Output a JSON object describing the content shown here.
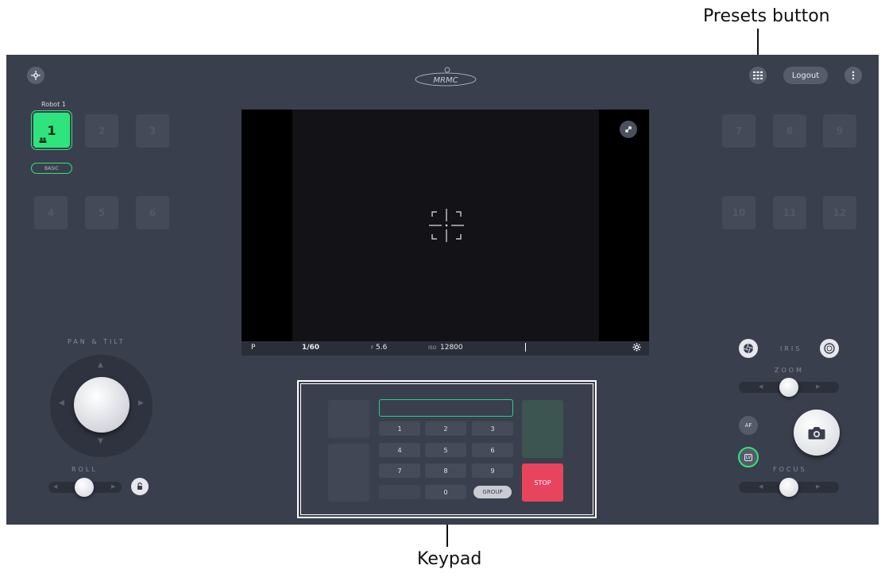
{
  "callouts": {
    "presets": "Presets button",
    "keypad": "Keypad"
  },
  "header": {
    "logo": "MRMC",
    "logout_label": "Logout"
  },
  "robot": {
    "label": "Robot 1",
    "mode_label": "BASIC",
    "left_slots": [
      "1",
      "2",
      "3",
      "4",
      "5",
      "6"
    ],
    "right_slots": [
      "7",
      "8",
      "9",
      "10",
      "11",
      "12"
    ],
    "active_slot": "1"
  },
  "camera_bar": {
    "mode": "P",
    "shutter": "1/60",
    "aperture_prefix": "F",
    "aperture": "5.6",
    "iso_prefix": "ISO",
    "iso": "12800"
  },
  "left_panel": {
    "pan_tilt_label": "PAN & TILT",
    "roll_label": "ROLL"
  },
  "keypad": {
    "keys": [
      "1",
      "2",
      "3",
      "4",
      "5",
      "6",
      "7",
      "8",
      "9",
      "0"
    ],
    "stop_label": "STOP",
    "group_label": "GROUP"
  },
  "right_panel": {
    "iris_label": "IRIS",
    "zoom_label": "ZOOM",
    "focus_label": "FOCUS",
    "af_label": "AF",
    "lv_label": "LV"
  },
  "colors": {
    "panel_bg": "#3a3f4d",
    "accent_green": "#2fe47c",
    "stop_red": "#e8445e"
  }
}
